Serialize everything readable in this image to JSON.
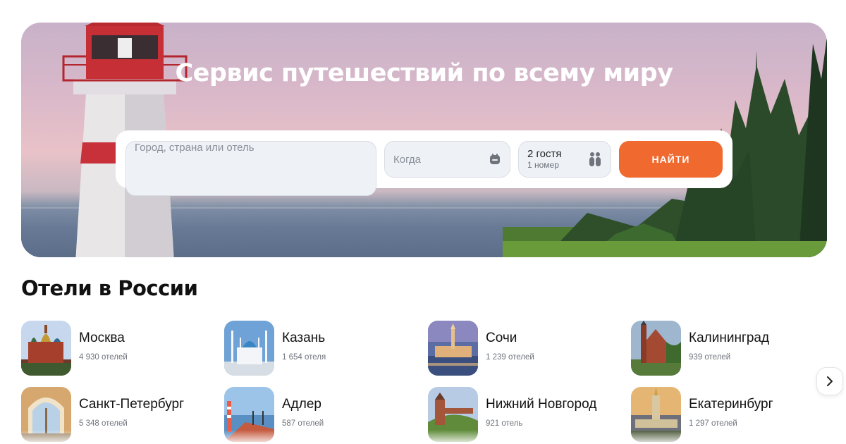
{
  "hero": {
    "title": "Сервис путешествий по всему миру"
  },
  "search": {
    "city_placeholder": "Город, страна или отель",
    "date_placeholder": "Когда",
    "guests_main": "2 гостя",
    "guests_sub": "1 номер",
    "submit_label": "НАЙТИ",
    "calendar_icon": "calendar-icon",
    "guests_icon": "guests-icon",
    "accent_color": "#f0692e"
  },
  "section": {
    "title": "Отели в России"
  },
  "cities": [
    {
      "name": "Москва",
      "count": "4 930 отелей"
    },
    {
      "name": "Казань",
      "count": "1 654 отеля"
    },
    {
      "name": "Сочи",
      "count": "1 239 отелей"
    },
    {
      "name": "Калининград",
      "count": "939 отелей"
    },
    {
      "name": "Санкт-Петербург",
      "count": "5 348 отелей"
    },
    {
      "name": "Адлер",
      "count": "587 отелей"
    },
    {
      "name": "Нижний Новгород",
      "count": "921 отель"
    },
    {
      "name": "Екатеринбург",
      "count": "1 297 отелей"
    }
  ],
  "carousel": {
    "next_icon": "chevron-right-icon"
  }
}
